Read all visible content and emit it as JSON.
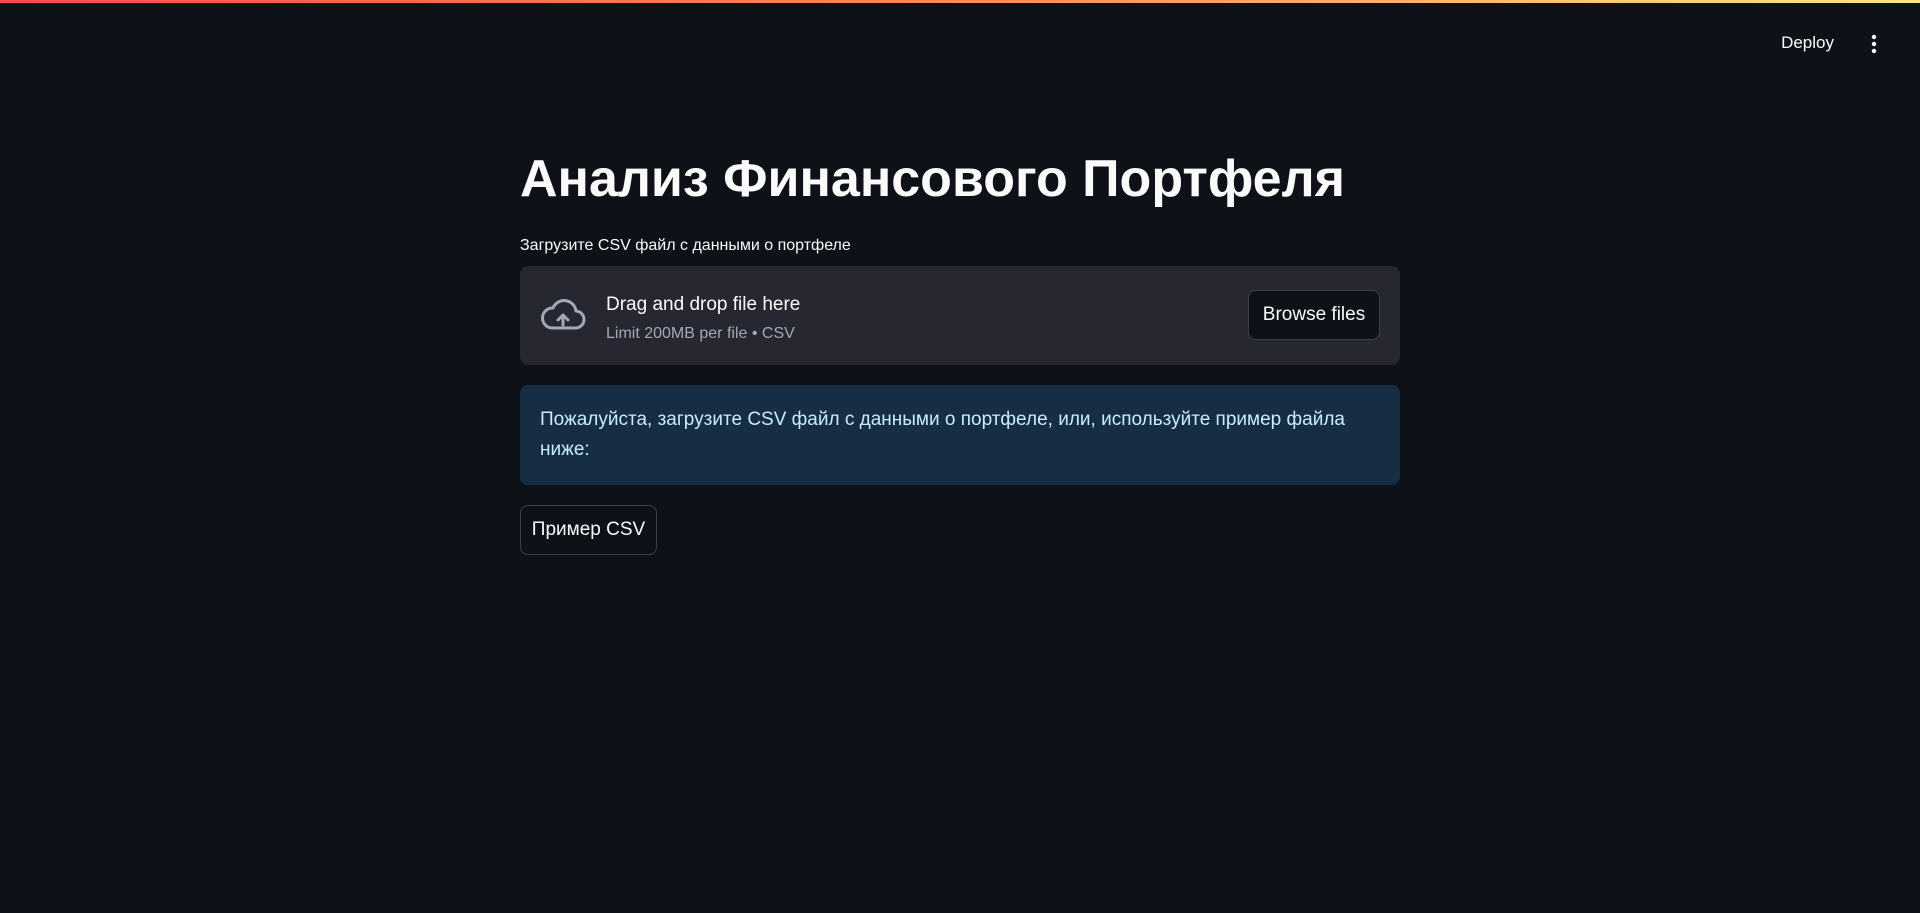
{
  "header": {
    "deploy_label": "Deploy",
    "menu_icon": "vertical-ellipsis-icon"
  },
  "main": {
    "title": "Анализ Финансового Портфеля",
    "uploader": {
      "label": "Загрузите CSV файл с данными о портфеле",
      "icon": "cloud-upload-icon",
      "drop_title": "Drag and drop file here",
      "drop_subtitle": "Limit 200MB per file • CSV",
      "browse_label": "Browse files"
    },
    "info_message": "Пожалуйста, загрузите CSV файл с данными о портфеле, или, используйте пример файла ниже:",
    "sample_button_label": "Пример CSV"
  },
  "colors": {
    "background": "#0e1117",
    "dropzone": "#262730",
    "info_background": "#172d43",
    "info_text": "#c7ebff",
    "accent_gradient_start": "#ff4b4b",
    "accent_gradient_end": "#ffe38c"
  }
}
